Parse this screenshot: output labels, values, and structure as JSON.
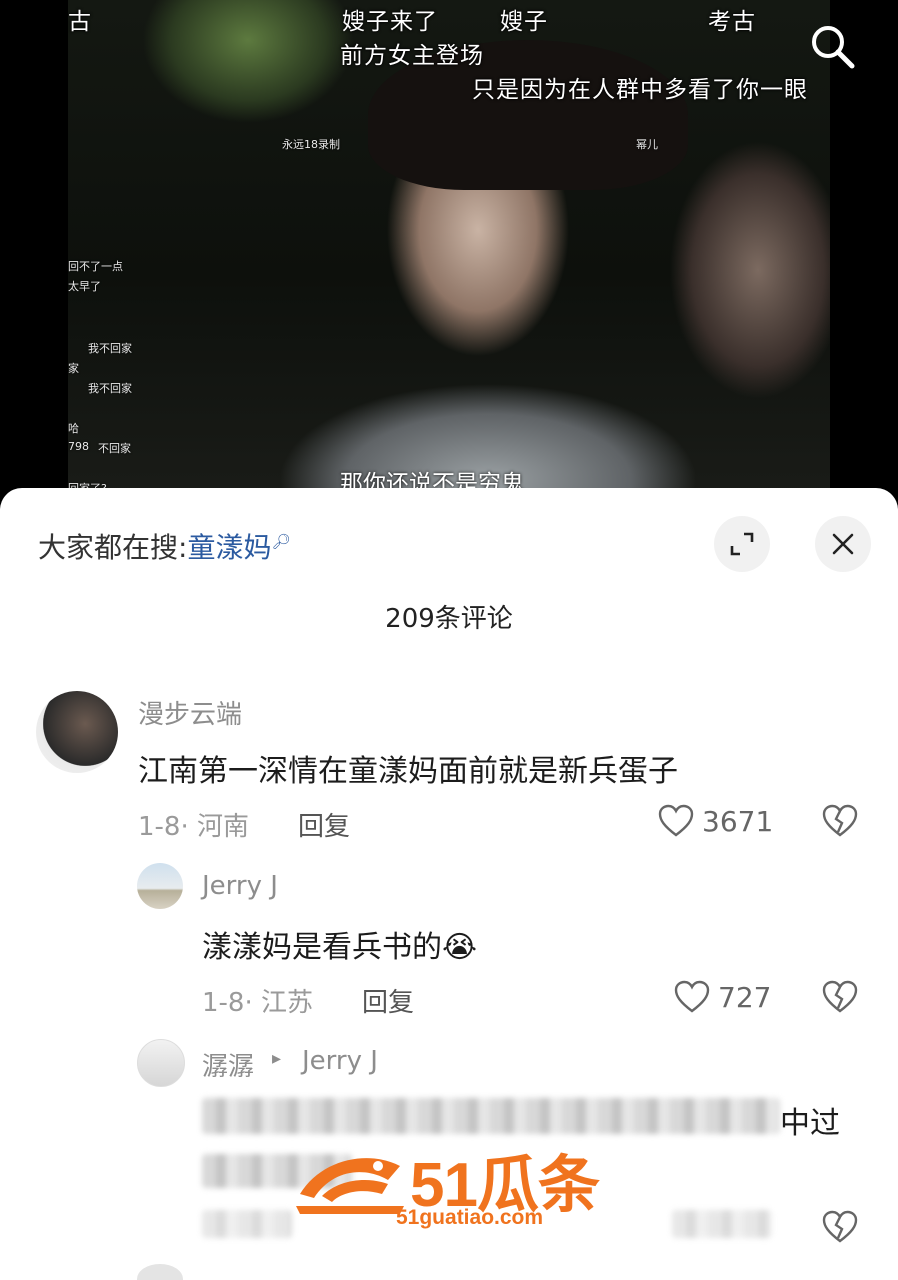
{
  "video": {
    "danmu": [
      "嫂子来了",
      "嫂子",
      "考古",
      "前方女主登场",
      "只是因为在人群中多看了你一眼",
      "古"
    ],
    "small_overlays": [
      "永远18录制",
      "幂儿",
      "回不了一点",
      "太早了",
      "我不回家",
      "我不回家",
      "家",
      "哈",
      "798",
      "不回家",
      "回家了?"
    ],
    "subtitle": "那你还说不是穷鬼",
    "search_icon": "search-icon"
  },
  "sheet": {
    "hot_search_prefix": "大家都在搜:",
    "hot_search_keyword": "童漾妈",
    "expand_icon": "expand-icon",
    "close_icon": "close-icon",
    "comment_count": "209条评论"
  },
  "comments": [
    {
      "username": "漫步云端",
      "text": "江南第一深情在童漾妈面前就是新兵蛋子",
      "meta": "1-8· 河南",
      "reply_label": "回复",
      "likes": "3671"
    },
    {
      "username": "Jerry J",
      "text": "漾漾妈是看兵书的😭",
      "meta": "1-8· 江苏",
      "reply_label": "回复",
      "likes": "727"
    },
    {
      "username": "潺潺",
      "reply_arrow": "▸",
      "reply_to": "Jerry J",
      "visible_text_end": "中过"
    }
  ],
  "watermark": {
    "brand": "51瓜条",
    "url": "51guatiao.com"
  },
  "colors": {
    "keyword_blue": "#2b5aa0",
    "watermark_orange": "#f0731e"
  }
}
